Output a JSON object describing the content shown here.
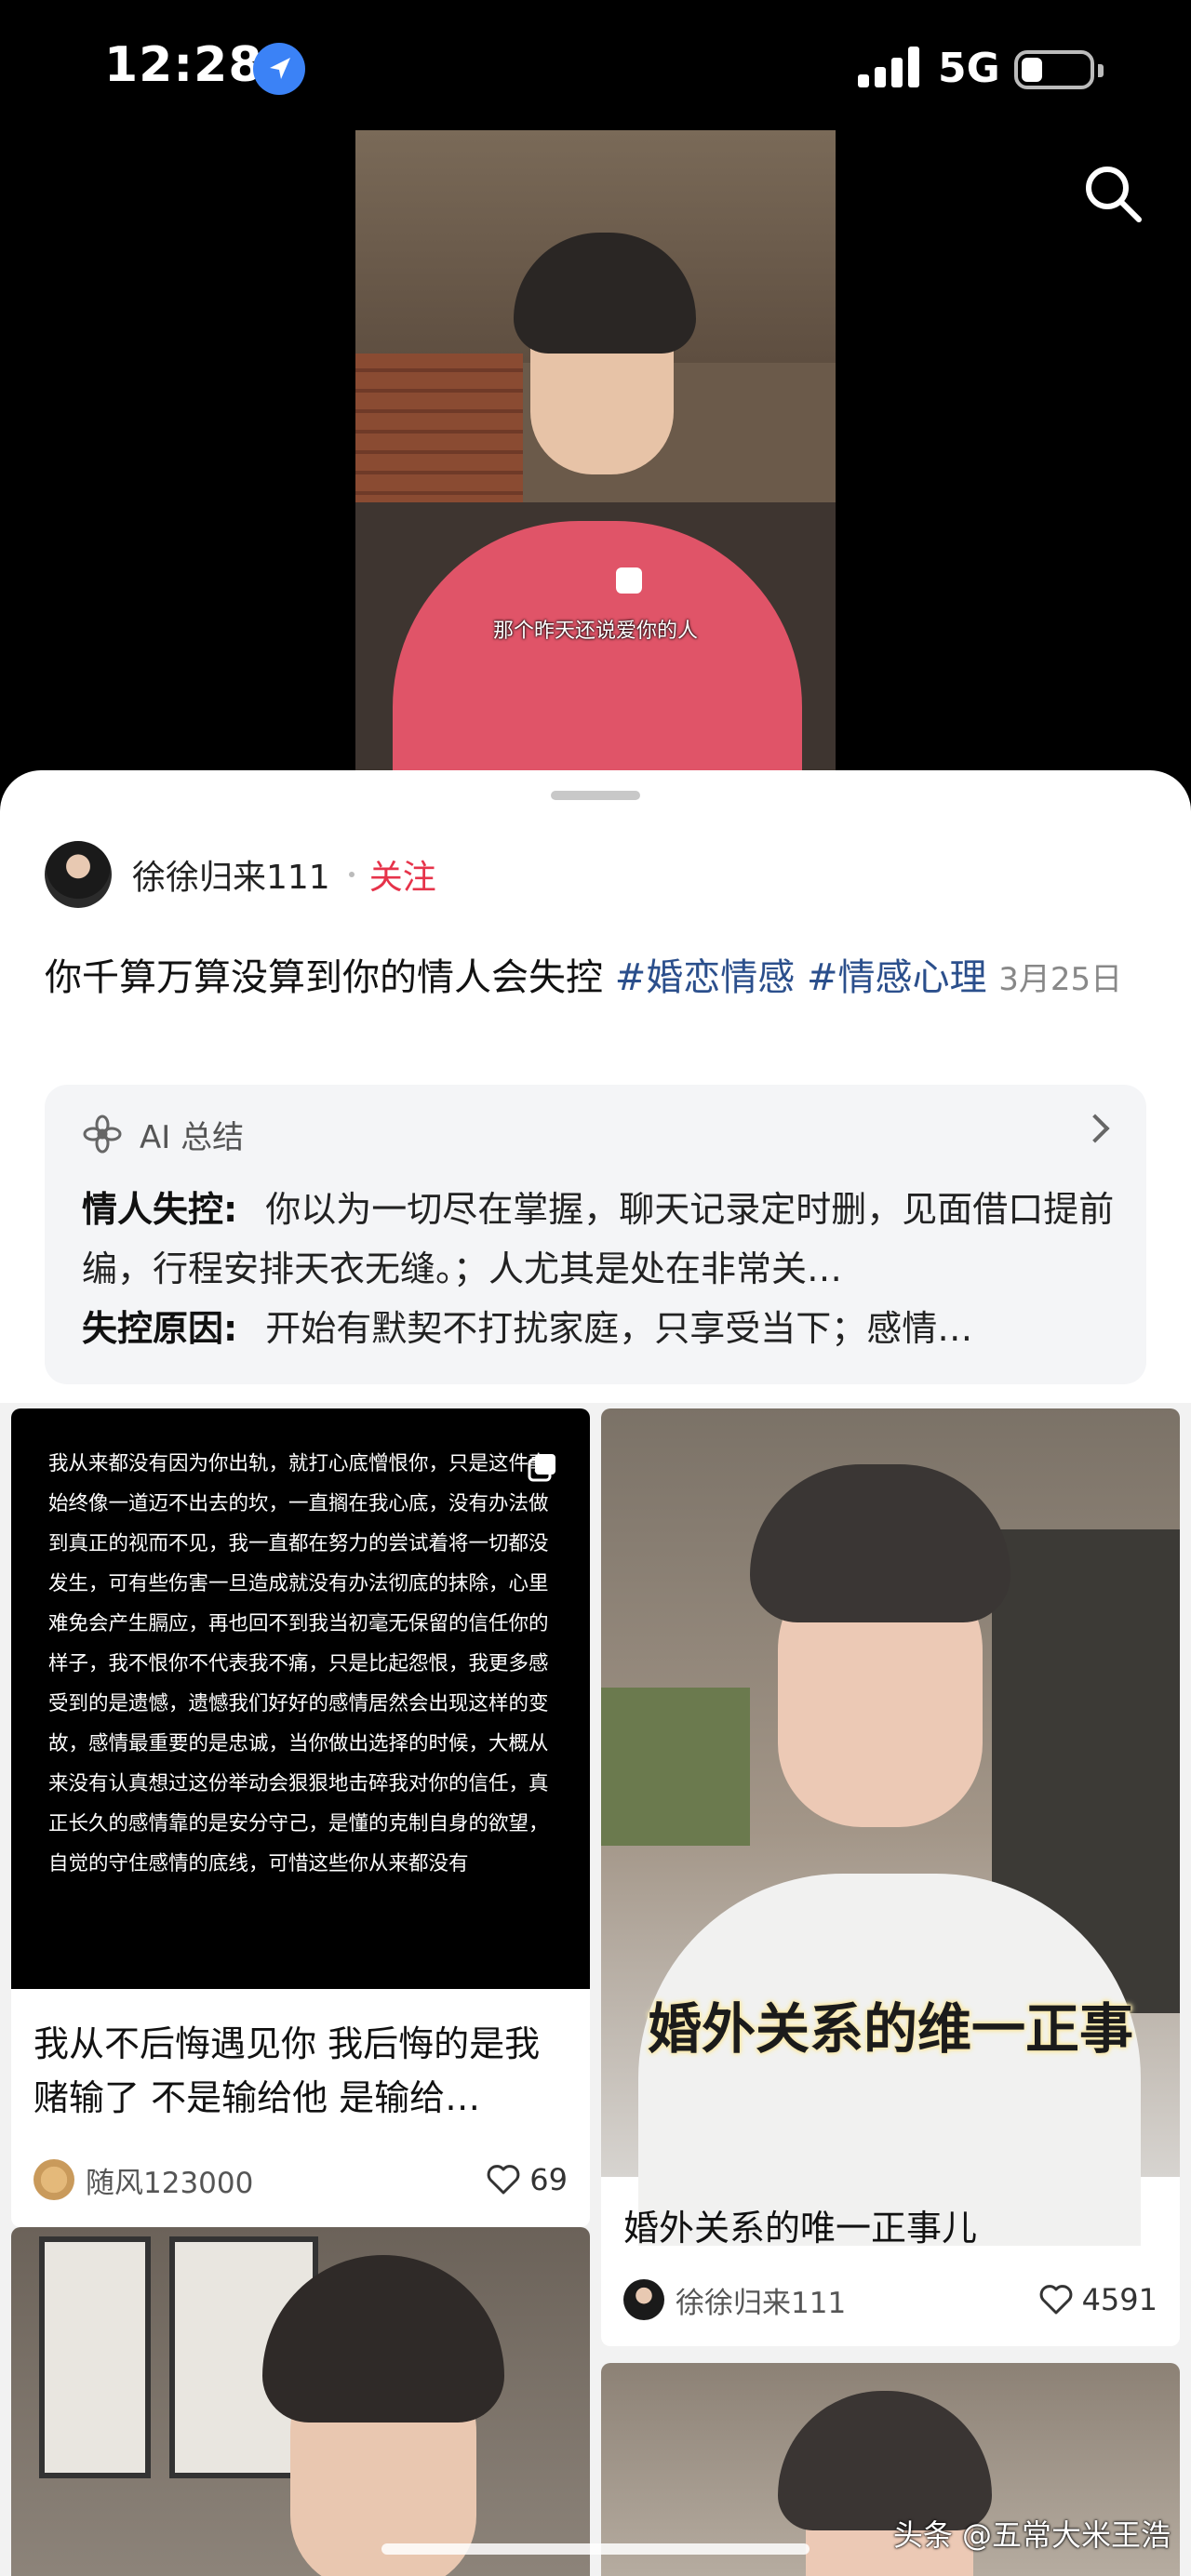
{
  "status_bar": {
    "time": "12:28",
    "network": "5G"
  },
  "video": {
    "subtitle": "那个昨天还说爱你的人"
  },
  "post": {
    "author": "徐徐归来111",
    "follow_label": "关注",
    "title": "你千算万算没算到你的情人会失控",
    "tags": [
      "#婚恋情感",
      "#情感心理"
    ],
    "date": "3月25日"
  },
  "ai_summary": {
    "label": "AI 总结",
    "items": [
      {
        "key": "情人失控:",
        "text": "你以为一切尽在掌握，聊天记录定时删，见面借口提前编，行程安排天衣无缝。；人尤其是处在非常关…"
      },
      {
        "key": "失控原因:",
        "text": "开始有默契不打扰家庭，只享受当下；感情…"
      }
    ]
  },
  "feed": [
    {
      "image_text": "我从来都没有因为你出轨，就打心底憎恨你，只是这件事始终像一道迈不出去的坎，一直搁在我心底，没有办法做到真正的视而不见，我一直都在努力的尝试着将一切都没发生，可有些伤害一旦造成就没有办法彻底的抹除，心里难免会产生膈应，再也回不到我当初毫无保留的信任你的样子，我不恨你不代表我不痛，只是比起怨恨，我更多感受到的是遗憾，遗憾我们好好的感情居然会出现这样的变故，感情最重要的是忠诚，当你做出选择的时候，大概从来没有认真想过这份举动会狠狠地击碎我对你的信任，真正长久的感情靠的是安分守己，是懂的克制自身的欲望，自觉的守住感情的底线，可惜这些你从来都没有",
      "title": "我从不后悔遇见你 我后悔的是我赌输了 不是输给他 是输给…",
      "author": "随风123000",
      "likes": "69"
    },
    {
      "banner": "婚外关系的维一正事",
      "title": "婚外关系的唯一正事儿",
      "author": "徐徐归来111",
      "likes": "4591"
    }
  ],
  "watermark": "头条 @五常大米王浩",
  "colors": {
    "accent_red": "#e6334a",
    "tag_blue": "#2b4f8c",
    "location_blue": "#3b82f6"
  }
}
